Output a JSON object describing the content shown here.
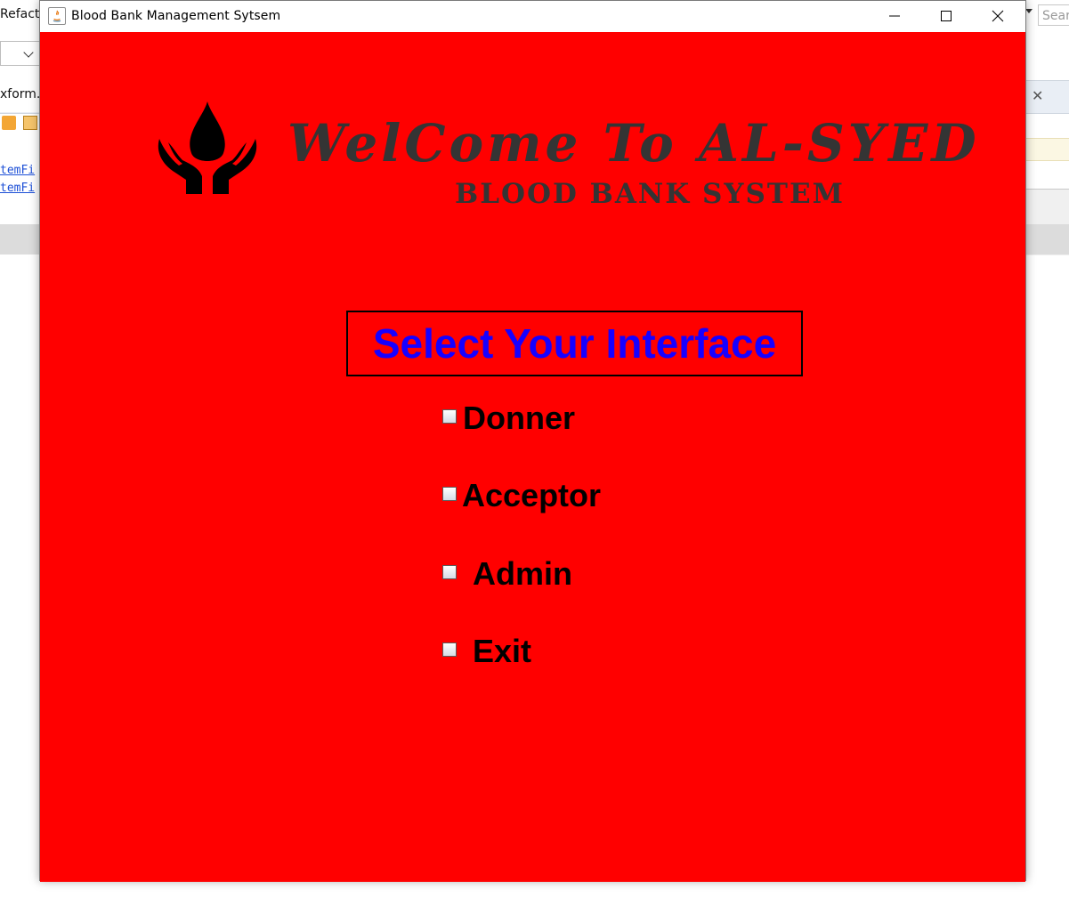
{
  "background_ide": {
    "menu_fragment": "Refacto",
    "search_placeholder": "Sear",
    "tab_fragment": "xform.ja",
    "code_line_1": "temFi",
    "code_line_2": "temFi"
  },
  "window": {
    "title": "Blood Bank Management Sytsem",
    "icon": "java-icon",
    "controls": [
      "minimize-icon",
      "maximize-icon",
      "close-icon"
    ]
  },
  "banner": {
    "logo": "blood-drop-hands-icon",
    "title": "WelCome To AL-SYED",
    "subtitle": "BLOOD BANK SYSTEM",
    "title_color": "#343434"
  },
  "main": {
    "heading": "Select Your Interface",
    "heading_color": "#1700ff",
    "background_color": "#ff0000",
    "options": [
      {
        "label": "Donner",
        "checked": false
      },
      {
        "label": "Acceptor",
        "checked": false
      },
      {
        "label": "Admin",
        "checked": false
      },
      {
        "label": "Exit",
        "checked": false
      }
    ]
  }
}
